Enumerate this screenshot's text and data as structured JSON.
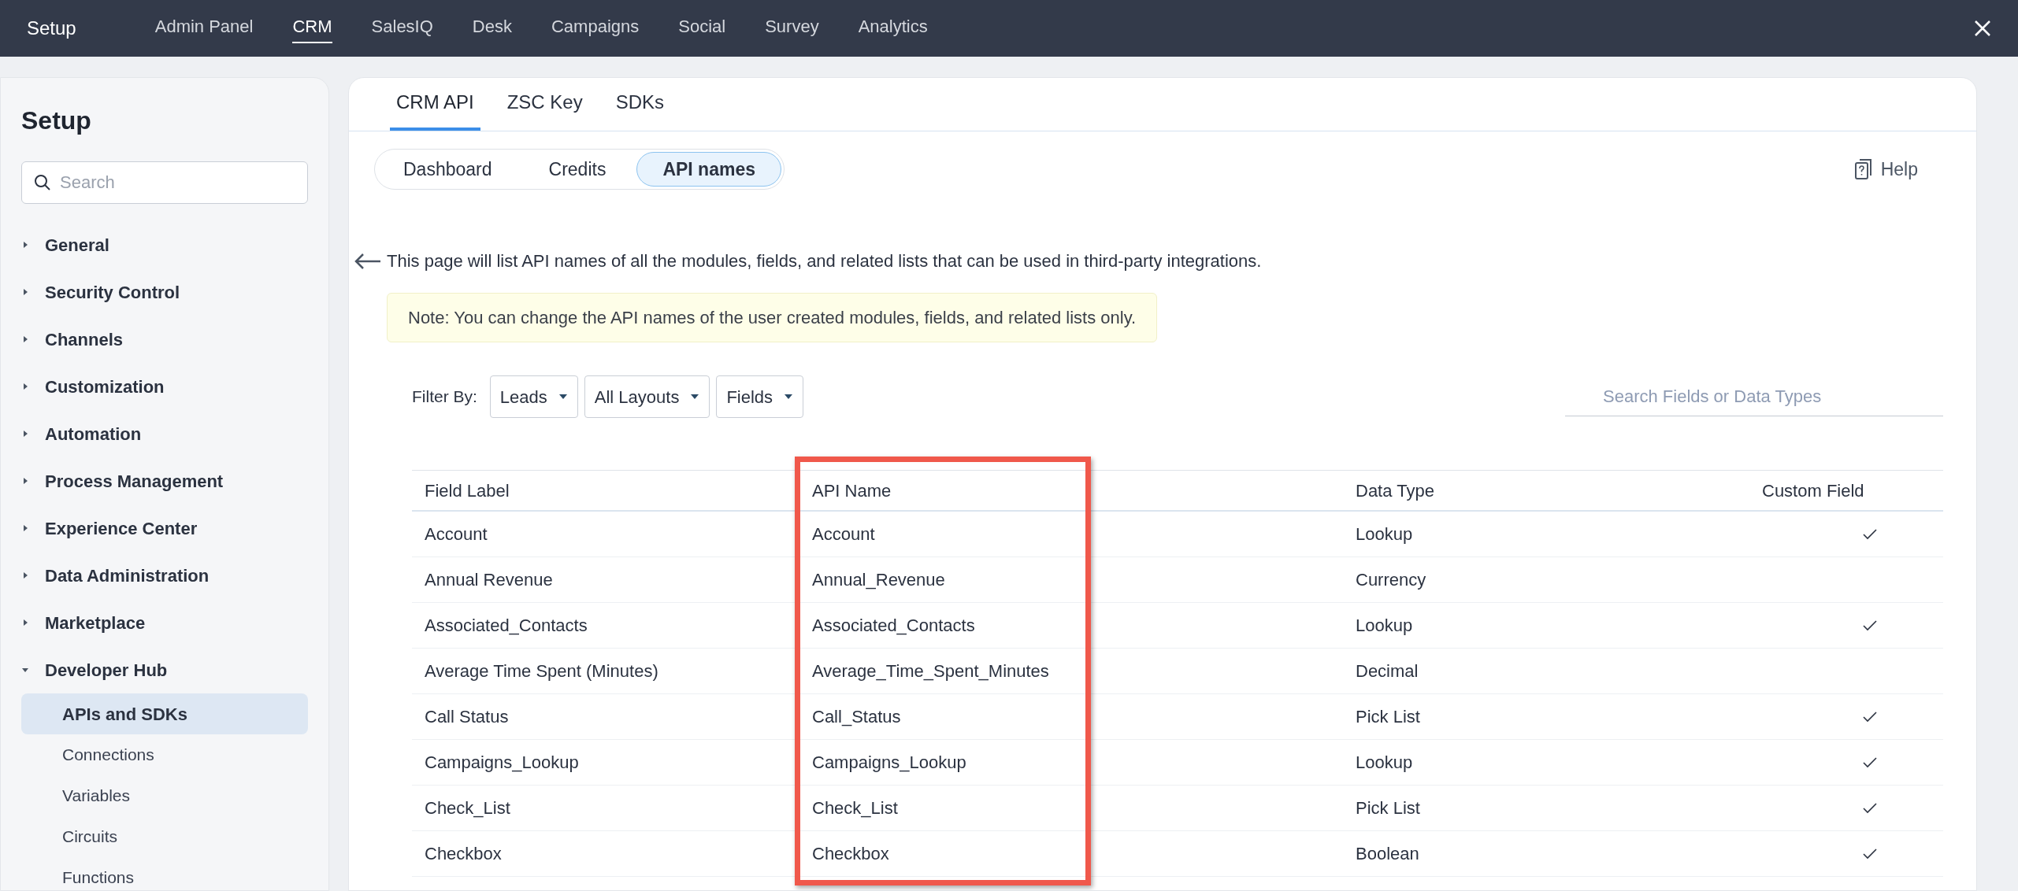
{
  "top_bar": {
    "title": "Setup",
    "apps": [
      {
        "label": "Admin Panel",
        "selected": false
      },
      {
        "label": "CRM",
        "selected": true
      },
      {
        "label": "SalesIQ",
        "selected": false
      },
      {
        "label": "Desk",
        "selected": false
      },
      {
        "label": "Campaigns",
        "selected": false
      },
      {
        "label": "Social",
        "selected": false
      },
      {
        "label": "Survey",
        "selected": false
      },
      {
        "label": "Analytics",
        "selected": false
      }
    ]
  },
  "sidebar": {
    "title": "Setup",
    "search_placeholder": "Search",
    "sections": [
      {
        "label": "General",
        "expanded": false
      },
      {
        "label": "Security Control",
        "expanded": false
      },
      {
        "label": "Channels",
        "expanded": false
      },
      {
        "label": "Customization",
        "expanded": false
      },
      {
        "label": "Automation",
        "expanded": false
      },
      {
        "label": "Process Management",
        "expanded": false
      },
      {
        "label": "Experience Center",
        "expanded": false
      },
      {
        "label": "Data Administration",
        "expanded": false
      },
      {
        "label": "Marketplace",
        "expanded": false
      },
      {
        "label": "Developer Hub",
        "expanded": true,
        "children": [
          {
            "label": "APIs and SDKs",
            "selected": true
          },
          {
            "label": "Connections",
            "selected": false
          },
          {
            "label": "Variables",
            "selected": false
          },
          {
            "label": "Circuits",
            "selected": false
          },
          {
            "label": "Functions",
            "selected": false
          }
        ]
      }
    ]
  },
  "tabs": [
    {
      "label": "CRM API",
      "selected": true
    },
    {
      "label": "ZSC Key",
      "selected": false
    },
    {
      "label": "SDKs",
      "selected": false
    }
  ],
  "subtabs": [
    {
      "label": "Dashboard",
      "selected": false
    },
    {
      "label": "Credits",
      "selected": false
    },
    {
      "label": "API names",
      "selected": true
    }
  ],
  "help": "Help",
  "description": "This page will list API names of all the modules, fields, and related lists that can be used in third-party integrations.",
  "note": "Note: You can change the API names of the user created modules, fields, and related lists only.",
  "filter": {
    "label": "Filter By:",
    "dropdowns": [
      "Leads",
      "All Layouts",
      "Fields"
    ]
  },
  "search_placeholder": "Search Fields or Data Types",
  "table": {
    "columns": [
      "Field Label",
      "API Name",
      "Data Type",
      "Custom Field"
    ],
    "rows": [
      {
        "field_label": "Account",
        "api_name": "Account",
        "data_type": "Lookup",
        "custom": true
      },
      {
        "field_label": "Annual Revenue",
        "api_name": "Annual_Revenue",
        "data_type": "Currency",
        "custom": false
      },
      {
        "field_label": "Associated_Contacts",
        "api_name": "Associated_Contacts",
        "data_type": "Lookup",
        "custom": true
      },
      {
        "field_label": "Average Time Spent (Minutes)",
        "api_name": "Average_Time_Spent_Minutes",
        "data_type": "Decimal",
        "custom": false
      },
      {
        "field_label": "Call Status",
        "api_name": "Call_Status",
        "data_type": "Pick List",
        "custom": true
      },
      {
        "field_label": "Campaigns_Lookup",
        "api_name": "Campaigns_Lookup",
        "data_type": "Lookup",
        "custom": true
      },
      {
        "field_label": "Check_List",
        "api_name": "Check_List",
        "data_type": "Pick List",
        "custom": true
      },
      {
        "field_label": "Checkbox",
        "api_name": "Checkbox",
        "data_type": "Boolean",
        "custom": true
      }
    ]
  }
}
